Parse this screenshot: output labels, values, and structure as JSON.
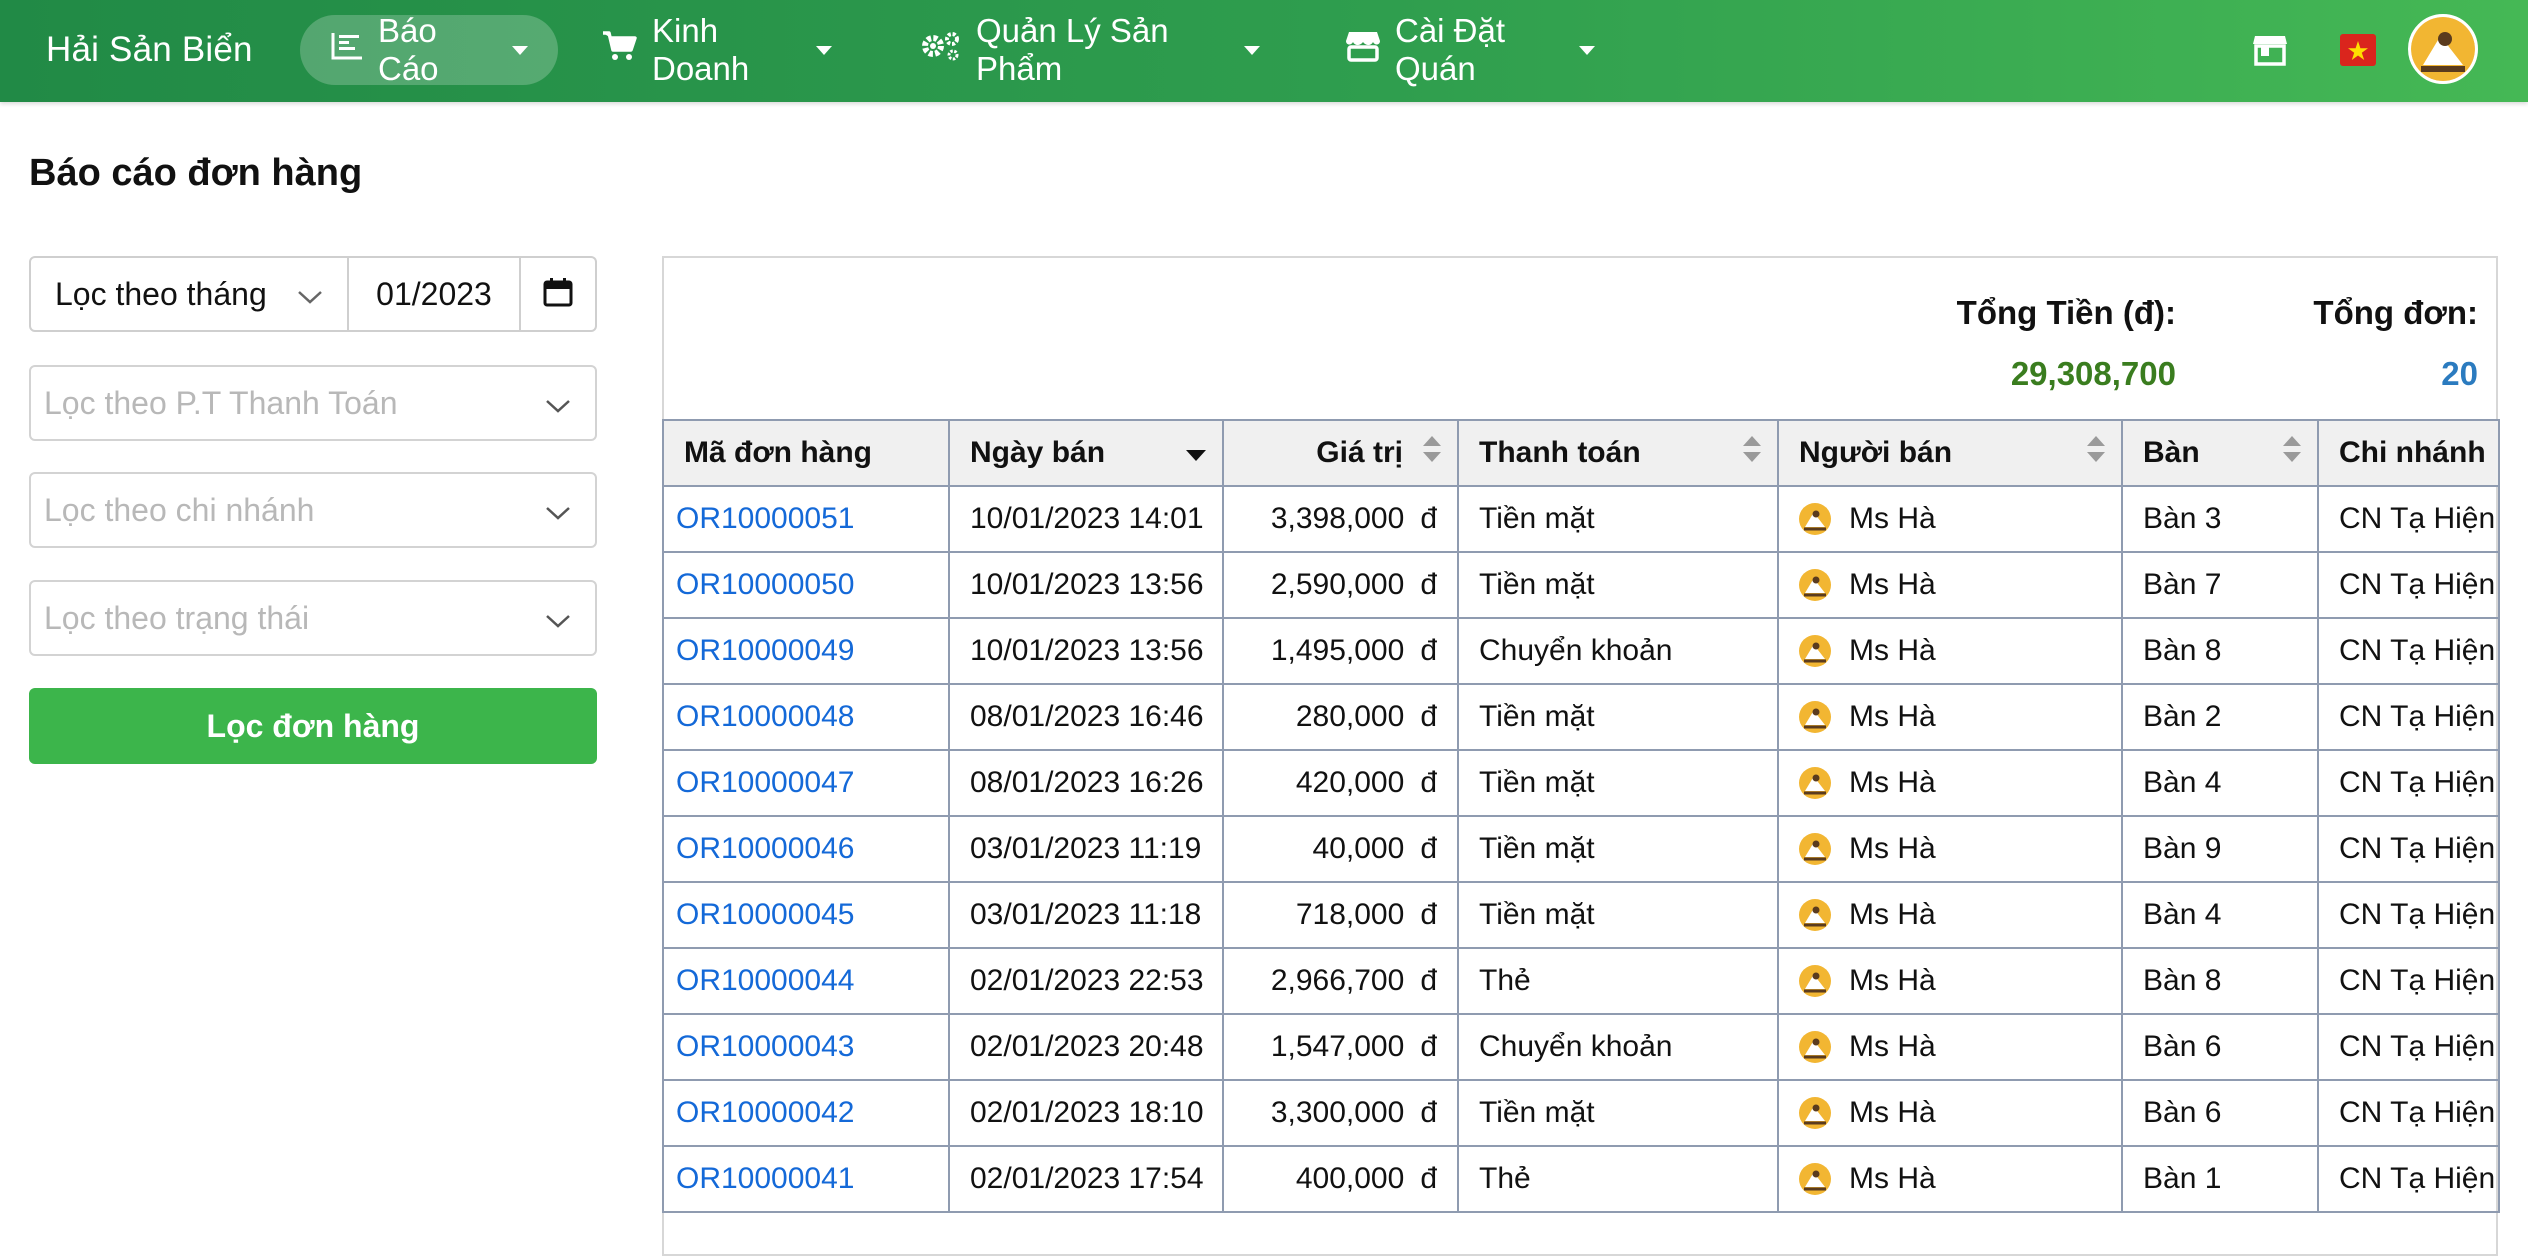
{
  "navbar": {
    "brand": "Hải Sản Biển",
    "menus": [
      {
        "label": "Báo Cáo",
        "icon": "chart-icon",
        "active": true
      },
      {
        "label": "Kinh Doanh",
        "icon": "cart-icon",
        "active": false
      },
      {
        "label": "Quản Lý Sản Phẩm",
        "icon": "gears-icon",
        "active": false
      },
      {
        "label": "Cài Đặt Quán",
        "icon": "store-icon",
        "active": false
      }
    ],
    "right_icons": [
      "shop-icon",
      "vietnam-flag-icon",
      "user-avatar"
    ]
  },
  "page": {
    "title": "Báo cáo đơn hàng"
  },
  "filters": {
    "period_select": "Lọc theo tháng",
    "month_value": "01/2023",
    "payment_placeholder": "Lọc theo P.T Thanh Toán",
    "branch_placeholder": "Lọc theo chi nhánh",
    "status_placeholder": "Lọc theo trạng thái",
    "submit_label": "Lọc đơn hàng"
  },
  "summary": {
    "total_amount_label": "Tổng Tiền (đ):",
    "total_amount_value": "29,308,700",
    "total_orders_label": "Tổng đơn:",
    "total_orders_value": "20"
  },
  "table": {
    "headers": [
      "Mã đơn hàng",
      "Ngày bán",
      "Giá trị",
      "Thanh toán",
      "Người bán",
      "Bàn",
      "Chi nhánh"
    ],
    "currency": "đ",
    "rows": [
      {
        "code": "OR10000051",
        "date": "10/01/2023 14:01",
        "value": "3,398,000",
        "payment": "Tiền mặt",
        "seller": "Ms Hà",
        "table": "Bàn 3",
        "branch": "CN Tạ Hiện"
      },
      {
        "code": "OR10000050",
        "date": "10/01/2023 13:56",
        "value": "2,590,000",
        "payment": "Tiền mặt",
        "seller": "Ms Hà",
        "table": "Bàn 7",
        "branch": "CN Tạ Hiện"
      },
      {
        "code": "OR10000049",
        "date": "10/01/2023 13:56",
        "value": "1,495,000",
        "payment": "Chuyển khoản",
        "seller": "Ms Hà",
        "table": "Bàn 8",
        "branch": "CN Tạ Hiện"
      },
      {
        "code": "OR10000048",
        "date": "08/01/2023 16:46",
        "value": "280,000",
        "payment": "Tiền mặt",
        "seller": "Ms Hà",
        "table": "Bàn 2",
        "branch": "CN Tạ Hiện"
      },
      {
        "code": "OR10000047",
        "date": "08/01/2023 16:26",
        "value": "420,000",
        "payment": "Tiền mặt",
        "seller": "Ms Hà",
        "table": "Bàn 4",
        "branch": "CN Tạ Hiện"
      },
      {
        "code": "OR10000046",
        "date": "03/01/2023 11:19",
        "value": "40,000",
        "payment": "Tiền mặt",
        "seller": "Ms Hà",
        "table": "Bàn 9",
        "branch": "CN Tạ Hiện"
      },
      {
        "code": "OR10000045",
        "date": "03/01/2023 11:18",
        "value": "718,000",
        "payment": "Tiền mặt",
        "seller": "Ms Hà",
        "table": "Bàn 4",
        "branch": "CN Tạ Hiện"
      },
      {
        "code": "OR10000044",
        "date": "02/01/2023 22:53",
        "value": "2,966,700",
        "payment": "Thẻ",
        "seller": "Ms Hà",
        "table": "Bàn 8",
        "branch": "CN Tạ Hiện"
      },
      {
        "code": "OR10000043",
        "date": "02/01/2023 20:48",
        "value": "1,547,000",
        "payment": "Chuyển khoản",
        "seller": "Ms Hà",
        "table": "Bàn 6",
        "branch": "CN Tạ Hiện"
      },
      {
        "code": "OR10000042",
        "date": "02/01/2023 18:10",
        "value": "3,300,000",
        "payment": "Tiền mặt",
        "seller": "Ms Hà",
        "table": "Bàn 6",
        "branch": "CN Tạ Hiện"
      },
      {
        "code": "OR10000041",
        "date": "02/01/2023 17:54",
        "value": "400,000",
        "payment": "Thẻ",
        "seller": "Ms Hà",
        "table": "Bàn 1",
        "branch": "CN Tạ Hiện"
      }
    ]
  },
  "colors": {
    "navbar_start": "#218a46",
    "navbar_end": "#45b855",
    "button_green": "#3cb54b",
    "total_amount": "#3a7d1f",
    "total_orders": "#2b7bbf",
    "link": "#1469d8"
  }
}
